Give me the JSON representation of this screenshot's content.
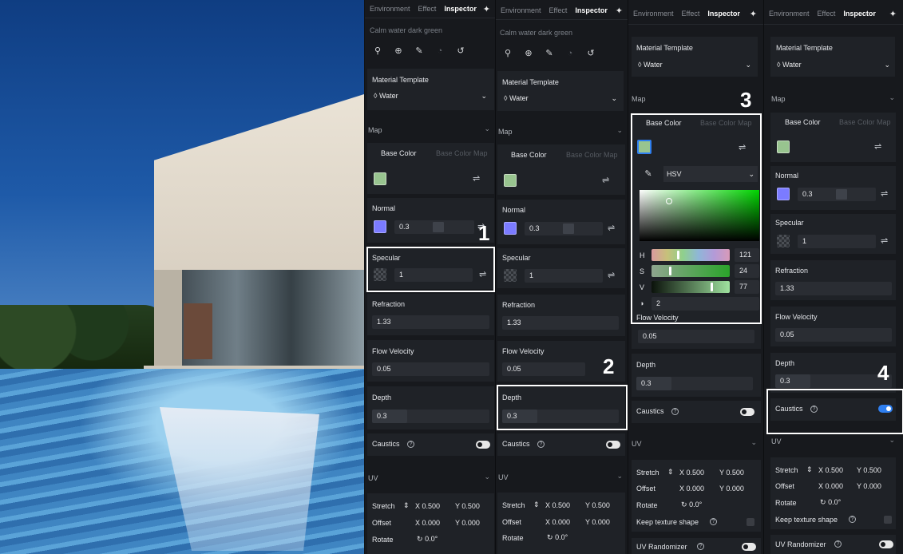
{
  "tabs": {
    "environment": "Environment",
    "effect": "Effect",
    "inspector": "Inspector"
  },
  "material_name": "Calm water dark green",
  "material_template": {
    "label": "Material Template",
    "value": "Water"
  },
  "map": {
    "label": "Map",
    "base_color_tab": "Base Color",
    "base_color_map_tab": "Base Color Map"
  },
  "normal": {
    "label": "Normal",
    "value": "0.3",
    "level": 0.3
  },
  "specular": {
    "label": "Specular",
    "value": "1"
  },
  "refraction": {
    "label": "Refraction",
    "value": "1.33"
  },
  "flow_velocity": {
    "label": "Flow Velocity",
    "value": "0.05"
  },
  "depth": {
    "label": "Depth",
    "value": "0.3",
    "level": 0.3
  },
  "caustics": {
    "label": "Caustics"
  },
  "uv": {
    "label": "UV",
    "stretch": "Stretch",
    "offset": "Offset",
    "rotate": "Rotate",
    "x_label": "X",
    "y_label": "Y",
    "stretch_x": "0.500",
    "stretch_y": "0.500",
    "offset_x": "0.000",
    "offset_y": "0.000",
    "rotate_value": "0.0°",
    "keep_texture_shape": "Keep texture shape",
    "uv_randomizer": "UV Randomizer"
  },
  "picker": {
    "mode": "HSV",
    "h_label": "H",
    "s_label": "S",
    "v_label": "V",
    "h_value": "121",
    "s_value": "24",
    "v_value": "77",
    "opacity_value": "2"
  },
  "callouts": [
    "1",
    "2",
    "3",
    "4"
  ],
  "colors": {
    "base_color": "#98c48f",
    "normal_color": "#7b7bff",
    "toggle_on": "#2f7ff0",
    "panel_bg": "#17191d"
  }
}
